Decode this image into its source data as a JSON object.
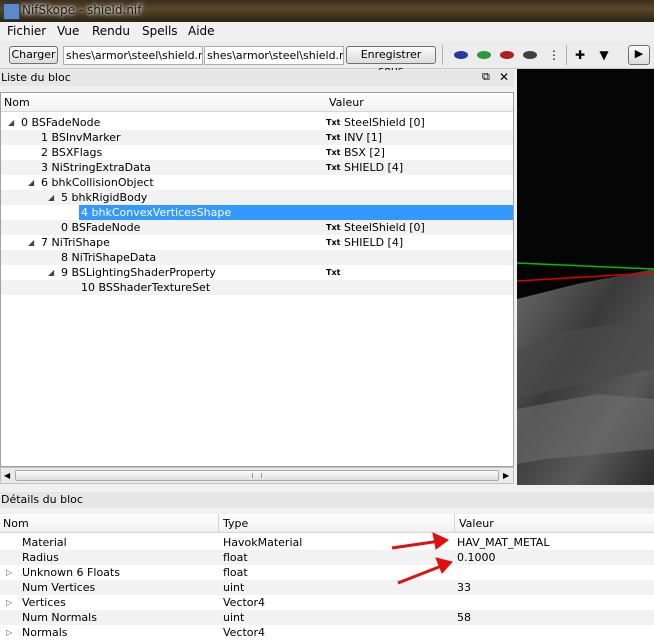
{
  "window": {
    "title": "NifSkope - shield.nif"
  },
  "menu": [
    "Fichier",
    "Vue",
    "Rendu",
    "Spells",
    "Aide"
  ],
  "toolbar": {
    "load_label": "Charger",
    "load_path": "shes\\armor\\steel\\shield.nif",
    "save_path": "shes\\armor\\steel\\shield.nif",
    "save_label": "Enregistrer sous"
  },
  "block_list": {
    "title": "Liste du bloc",
    "col_name": "Nom",
    "col_value": "Valeur",
    "rows": [
      {
        "name": "0 BSFadeNode",
        "indent": 0,
        "arrow": "open",
        "txt": "Txt",
        "value": "SteelShield [0]"
      },
      {
        "name": "1 BSInvMarker",
        "indent": 1,
        "arrow": "",
        "txt": "Txt",
        "value": "INV [1]"
      },
      {
        "name": "2 BSXFlags",
        "indent": 1,
        "arrow": "",
        "txt": "Txt",
        "value": "BSX [2]"
      },
      {
        "name": "3 NiStringExtraData",
        "indent": 1,
        "arrow": "",
        "txt": "Txt",
        "value": "SHIELD [4]"
      },
      {
        "name": "6 bhkCollisionObject",
        "indent": 1,
        "arrow": "open",
        "txt": "",
        "value": ""
      },
      {
        "name": "5 bhkRigidBody",
        "indent": 2,
        "arrow": "open",
        "txt": "",
        "value": ""
      },
      {
        "name": "4 bhkConvexVerticesShape",
        "indent": 3,
        "arrow": "",
        "txt": "",
        "value": "",
        "selected": true
      },
      {
        "name": "0 BSFadeNode",
        "indent": 2,
        "arrow": "",
        "txt": "Txt",
        "value": "SteelShield [0]"
      },
      {
        "name": "7 NiTriShape",
        "indent": 1,
        "arrow": "open",
        "txt": "Txt",
        "value": "SHIELD [4]"
      },
      {
        "name": "8 NiTriShapeData",
        "indent": 2,
        "arrow": "",
        "txt": "",
        "value": ""
      },
      {
        "name": "9 BSLightingShaderProperty",
        "indent": 2,
        "arrow": "open",
        "txt": "Txt",
        "value": ""
      },
      {
        "name": "10 BSShaderTextureSet",
        "indent": 3,
        "arrow": "",
        "txt": "",
        "value": ""
      }
    ]
  },
  "block_details": {
    "title": "Détails du bloc",
    "col_name": "Nom",
    "col_type": "Type",
    "col_value": "Valeur",
    "rows": [
      {
        "name": "Material",
        "type": "HavokMaterial",
        "value": "HAV_MAT_METAL",
        "expand": false
      },
      {
        "name": "Radius",
        "type": "float",
        "value": "0.1000",
        "expand": false
      },
      {
        "name": "Unknown 6 Floats",
        "type": "float",
        "value": "",
        "expand": true
      },
      {
        "name": "Num Vertices",
        "type": "uint",
        "value": "33",
        "expand": false
      },
      {
        "name": "Vertices",
        "type": "Vector4",
        "value": "",
        "expand": true
      },
      {
        "name": "Num Normals",
        "type": "uint",
        "value": "58",
        "expand": false
      },
      {
        "name": "Normals",
        "type": "Vector4",
        "value": "",
        "expand": true
      }
    ]
  },
  "colors": {
    "selection": "#3399ff",
    "annotation_arrow": "#e01010",
    "axis_green": "#00c000",
    "axis_red": "#e00000"
  }
}
